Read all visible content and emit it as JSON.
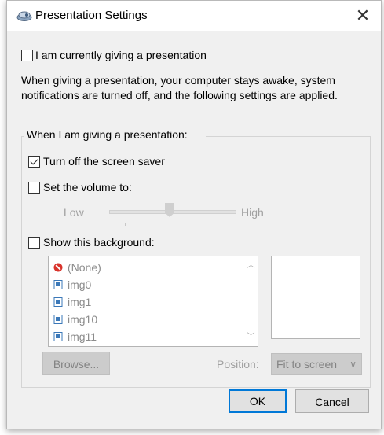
{
  "window": {
    "title": "Presentation Settings",
    "close_glyph": "✕"
  },
  "presenting": {
    "label": "I am currently giving a presentation",
    "checked": false
  },
  "description": "When giving a presentation, your computer stays awake, system notifications are turned off, and the following settings are applied.",
  "group": {
    "label": "When I am giving a presentation:",
    "screensaver": {
      "label": "Turn off the screen saver",
      "checked": true
    },
    "volume": {
      "label": "Set the volume to:",
      "checked": false,
      "low_label": "Low",
      "high_label": "High",
      "level": 0.5
    },
    "background": {
      "label": "Show this background:",
      "checked": false,
      "items": [
        {
          "label": "(None)",
          "icon": "no-symbol-icon"
        },
        {
          "label": "img0",
          "icon": "image-file-icon"
        },
        {
          "label": "img1",
          "icon": "image-file-icon"
        },
        {
          "label": "img10",
          "icon": "image-file-icon"
        },
        {
          "label": "img11",
          "icon": "image-file-icon"
        }
      ],
      "browse_label": "Browse...",
      "position_label": "Position:",
      "position_value": "Fit to screen"
    }
  },
  "buttons": {
    "ok": "OK",
    "cancel": "Cancel"
  },
  "colors": {
    "accent": "#0078d7",
    "disabled_text": "#a0a0a0"
  }
}
